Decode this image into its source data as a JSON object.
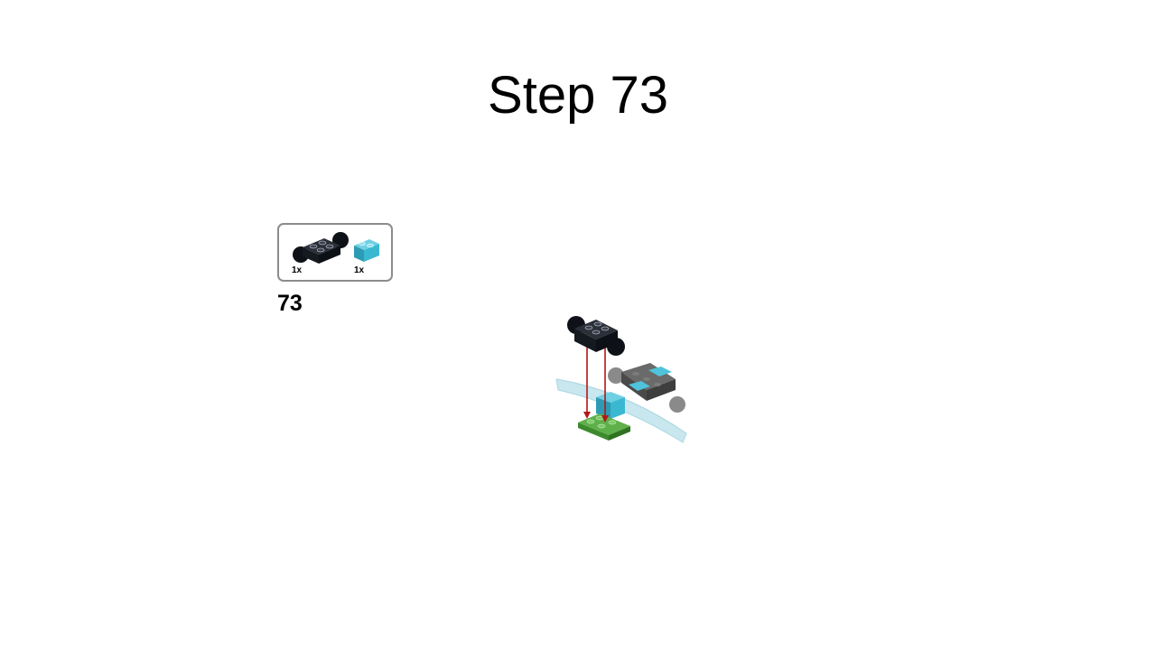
{
  "slide": {
    "title": "Step 73"
  },
  "parts_callout": {
    "items": [
      {
        "icon": "black-brick-2x2-with-ball-joints-icon",
        "quantity": "1x",
        "color": "#1b1f27"
      },
      {
        "icon": "medium-azure-brick-1x2-icon",
        "quantity": "1x",
        "color": "#3bb8d1"
      }
    ]
  },
  "step": {
    "number": "73"
  },
  "colors": {
    "black_part": "#1b1f27",
    "azure_part": "#3bb8d1",
    "green_plate": "#4a9a3a",
    "dark_gray_part": "#5a5a5a",
    "trans_clear_wing": "#bfe3ec",
    "arrow_red": "#b01818",
    "box_border": "#8c8c8c"
  }
}
